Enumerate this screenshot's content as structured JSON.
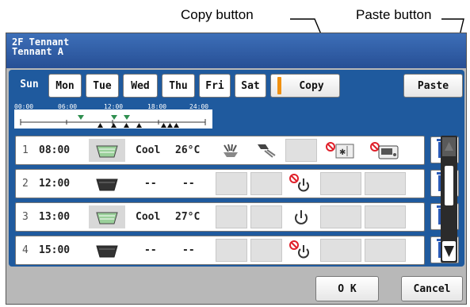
{
  "callouts": {
    "copy": "Copy button",
    "paste": "Paste button"
  },
  "header": {
    "line1": "2F Tennant",
    "line2": "Tennant A"
  },
  "days": [
    {
      "label": "Sun",
      "active": true
    },
    {
      "label": "Mon",
      "active": false
    },
    {
      "label": "Tue",
      "active": false
    },
    {
      "label": "Wed",
      "active": false
    },
    {
      "label": "Thu",
      "active": false
    },
    {
      "label": "Fri",
      "active": false
    },
    {
      "label": "Sat",
      "active": false
    }
  ],
  "toolbar": {
    "copy_label": "Copy",
    "paste_label": "Paste"
  },
  "timeline": {
    "ticks": [
      "00:00",
      "06:00",
      "12:00",
      "18:00",
      "24:00"
    ]
  },
  "rows": [
    {
      "num": "1",
      "time": "08:00",
      "unit": "on",
      "mode": "Cool",
      "temp": "26°C"
    },
    {
      "num": "2",
      "time": "12:00",
      "unit": "off",
      "mode": "--",
      "temp": "--"
    },
    {
      "num": "3",
      "time": "13:00",
      "unit": "on",
      "mode": "Cool",
      "temp": "27°C"
    },
    {
      "num": "4",
      "time": "15:00",
      "unit": "off",
      "mode": "--",
      "temp": "--"
    }
  ],
  "footer": {
    "ok_label": "O K",
    "cancel_label": "Cancel"
  },
  "colors": {
    "panel": "#1f5a9e",
    "title_bar": "#2f5fa8",
    "prohibit": "#e0202a",
    "trash": "#2a5ab5"
  }
}
